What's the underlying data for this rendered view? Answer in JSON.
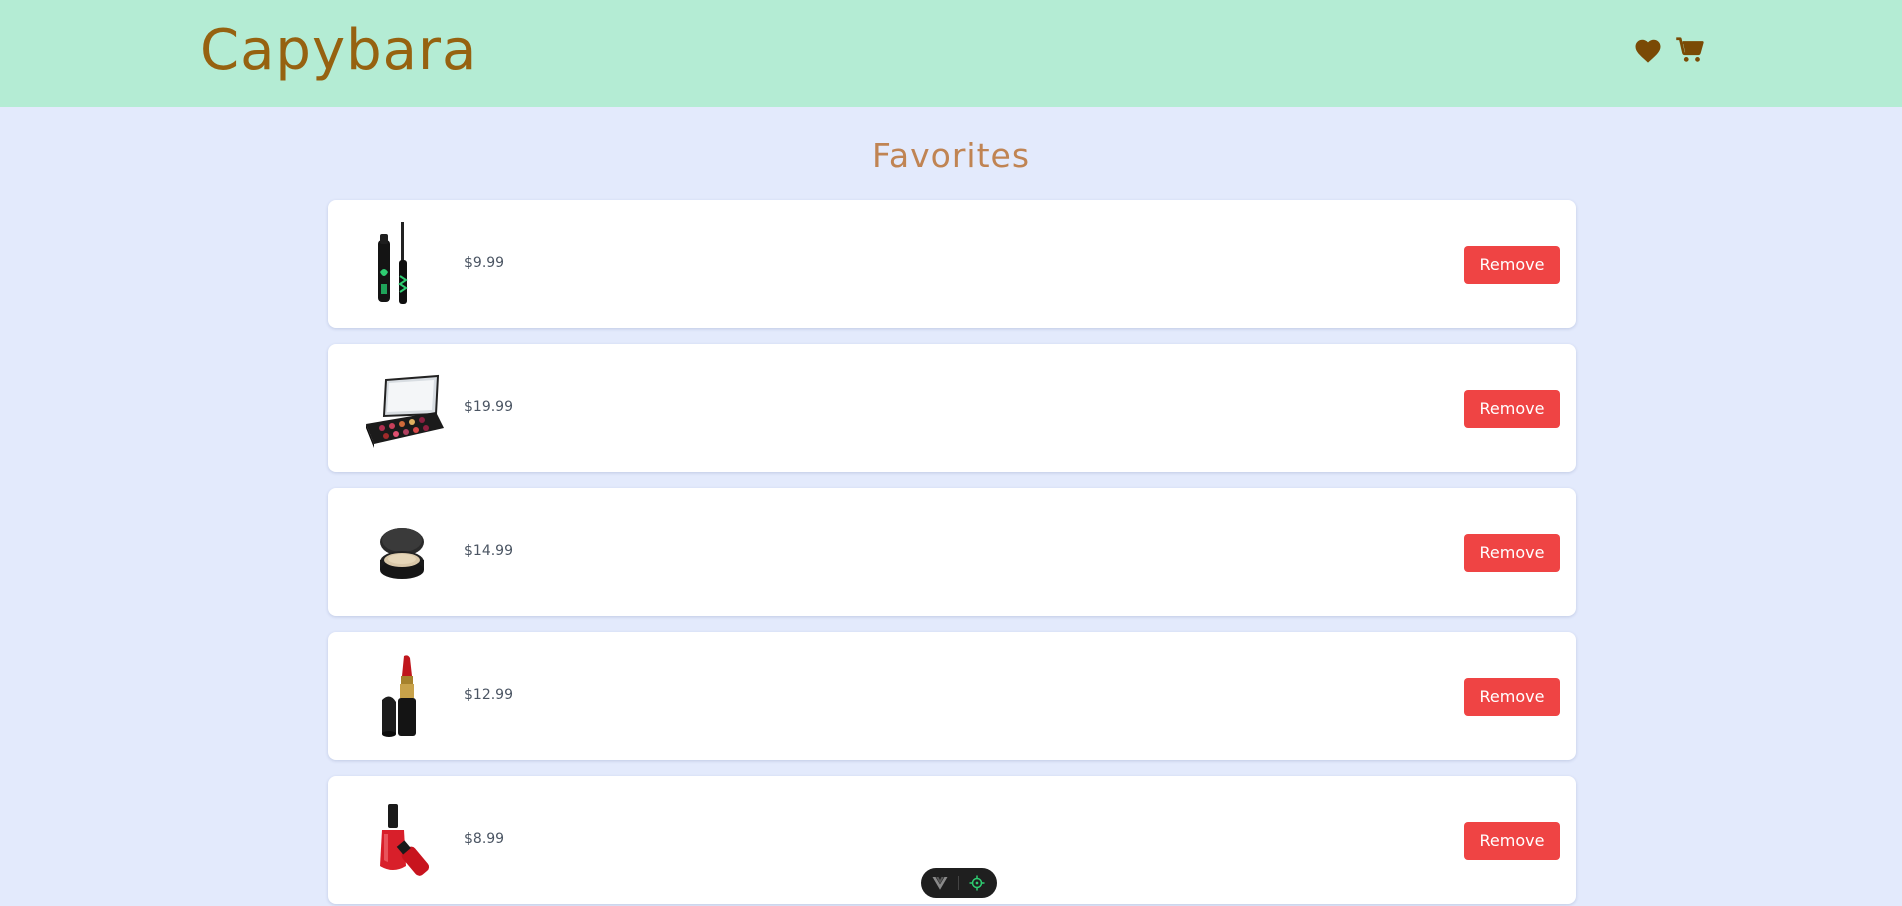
{
  "header": {
    "logo_text": "Capybara",
    "favorites_icon": "heart-icon",
    "cart_icon": "cart-icon",
    "colors": {
      "bar": "#b4ecd4",
      "logo": "#966210",
      "icons": "#7a4a05"
    }
  },
  "page": {
    "title": "Favorites",
    "background": "#e3eafc"
  },
  "favorites": [
    {
      "image": "mascara-image",
      "price": "$9.99",
      "remove_label": "Remove"
    },
    {
      "image": "eyeshadow-palette-image",
      "price": "$19.99",
      "remove_label": "Remove"
    },
    {
      "image": "compact-powder-image",
      "price": "$14.99",
      "remove_label": "Remove"
    },
    {
      "image": "lipstick-image",
      "price": "$12.99",
      "remove_label": "Remove"
    },
    {
      "image": "nail-polish-image",
      "price": "$8.99",
      "remove_label": "Remove"
    }
  ],
  "remove_button_color": "#ef4444",
  "devtools": {
    "left_icon": "vue-logo-icon",
    "right_icon": "target-icon"
  }
}
